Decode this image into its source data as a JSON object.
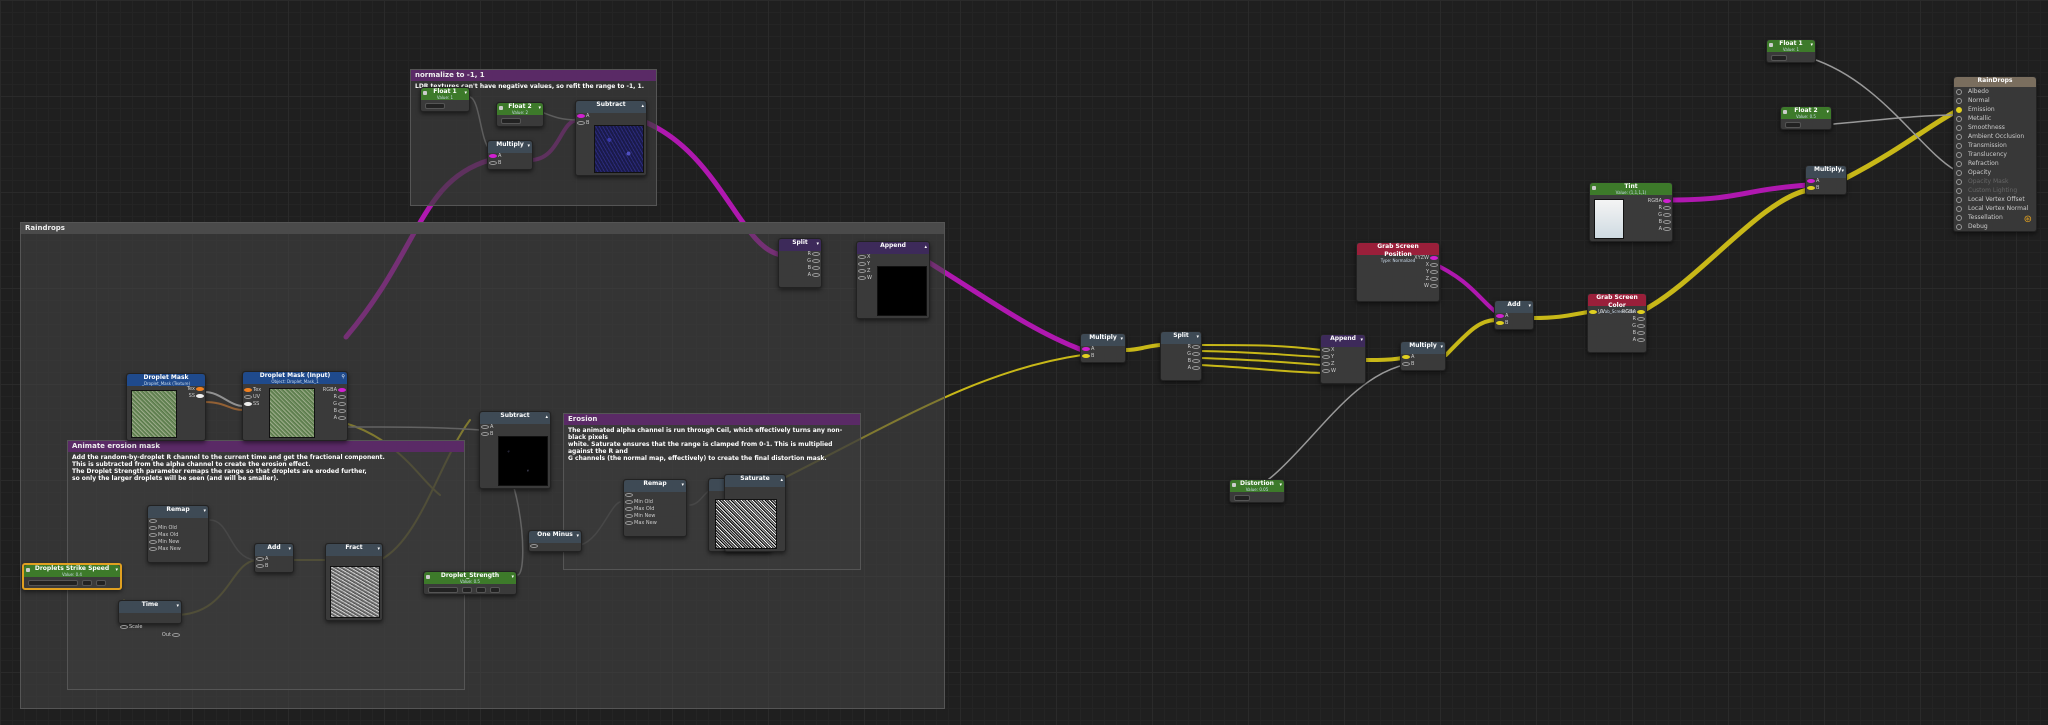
{
  "colors": {
    "magenta": "#d020d0",
    "yellow": "#e0d020",
    "white": "#eeeeee",
    "group_purple": "#5a2a66"
  },
  "groups": {
    "normalize": {
      "title": "normalize to -1, 1",
      "note": "LDR textures can't have negative values, so refit the range to -1, 1."
    },
    "raindrops": {
      "title": "Raindrops"
    },
    "animate": {
      "title": "Animate erosion mask",
      "note": "Add the random-by-droplet R channel to the current time and get the fractional component.\nThis is subtracted from the alpha channel to create the erosion effect.\nThe Droplet Strength parameter remaps the range so that droplets are eroded further,\nso only the larger droplets will be seen (and will be smaller)."
    },
    "erosion": {
      "title": "Erosion",
      "note": "The animated alpha channel is run through Ceil, which effectively turns any non-black pixels\nwhite. Saturate ensures that the range is clamped from 0-1. This is multiplied against the R and\nG channels (the normal map, effectively) to create the final distortion mask."
    }
  },
  "nodes": {
    "float_a": {
      "title": "Float 1",
      "sub": "Value: 1"
    },
    "float_b": {
      "title": "Float 2",
      "sub": "Value: 2"
    },
    "multiply1": {
      "title": "Multiply",
      "ports": [
        "A",
        "B"
      ]
    },
    "subtract1": {
      "title": "Subtract",
      "ports": [
        "A",
        "B"
      ]
    },
    "split1": {
      "title": "Split",
      "ports": [
        "R",
        "G",
        "B",
        "A"
      ]
    },
    "append1": {
      "title": "Append",
      "ports": [
        "X",
        "Y",
        "Z",
        "W"
      ]
    },
    "droplet_mask": {
      "title": "Droplet Mask",
      "sub": "_Droplet_Mask (Texture)",
      "ports": [
        "Tex",
        "SS"
      ]
    },
    "droplet_mask_input": {
      "title": "Droplet Mask (Input)",
      "sub": "Object: Droplet_Mask_1",
      "ports_in": [
        "Tex",
        "UV",
        "SS"
      ],
      "ports_out": [
        "RGBA",
        "R",
        "G",
        "B",
        "A"
      ]
    },
    "subtract2": {
      "title": "Subtract",
      "ports": [
        "A",
        "B"
      ]
    },
    "remap1": {
      "title": "Remap",
      "ports": [
        "",
        "Min Old",
        "Max Old",
        "Min New",
        "Max New"
      ]
    },
    "add1": {
      "title": "Add",
      "ports": [
        "A",
        "B"
      ]
    },
    "frac": {
      "title": "Fract"
    },
    "time": {
      "title": "Time",
      "ports": [
        "Scale"
      ],
      "out": "Out"
    },
    "speed": {
      "title": "Droplets Strike Speed",
      "sub": "Value: 0.4"
    },
    "strength": {
      "title": "Droplet_Strength",
      "sub": "Value: 0.5"
    },
    "one_minus": {
      "title": "One Minus"
    },
    "remap2": {
      "title": "Remap",
      "ports": [
        "",
        "Min Old",
        "Max Old",
        "Min New",
        "Max New"
      ]
    },
    "saturate": {
      "title": "Saturate"
    },
    "multiply2": {
      "title": "Multiply",
      "ports": [
        "A",
        "B"
      ]
    },
    "split2": {
      "title": "Split",
      "ports": [
        "R",
        "G",
        "B",
        "A"
      ]
    },
    "append2": {
      "title": "Append",
      "ports": [
        "X",
        "Y",
        "Z",
        "W"
      ]
    },
    "multiply3": {
      "title": "Multiply",
      "ports": [
        "A",
        "B"
      ]
    },
    "grab_pos": {
      "title": "Grab Screen Position",
      "sub": "Type: Normalized",
      "ports": [
        "XYZW",
        "X",
        "Y",
        "Z",
        "W"
      ]
    },
    "add2": {
      "title": "Add",
      "ports": [
        "A",
        "B"
      ]
    },
    "grab_color": {
      "title": "Grab Screen Color",
      "sub": "_Grab_ScreenColor",
      "ports_in": [
        "UV"
      ],
      "ports_out": [
        "RGBA",
        "R",
        "G",
        "B",
        "A"
      ]
    },
    "distortion": {
      "title": "Distortion",
      "sub": "Value: 0.05"
    },
    "tint": {
      "title": "Tint",
      "sub": "Value: (1,1,1,1)",
      "ports": [
        "RGBA",
        "R",
        "G",
        "B",
        "A"
      ]
    },
    "multiply4": {
      "title": "Multiply",
      "ports": [
        "A",
        "B"
      ]
    },
    "float_1": {
      "title": "Float 1",
      "sub": "Value: 1"
    },
    "float_2": {
      "title": "Float 2",
      "sub": "Value: 0.5"
    }
  },
  "material": {
    "title": "RainDrops",
    "items": [
      "Albedo",
      "Normal",
      "Emission",
      "Metallic",
      "Smoothness",
      "Ambient Occlusion",
      "Transmission",
      "Translucency",
      "Refraction",
      "Opacity",
      "Opacity Mask",
      "Custom Lighting",
      "Local Vertex Offset",
      "Local Vertex Normal",
      "Tessellation",
      "Debug"
    ]
  }
}
